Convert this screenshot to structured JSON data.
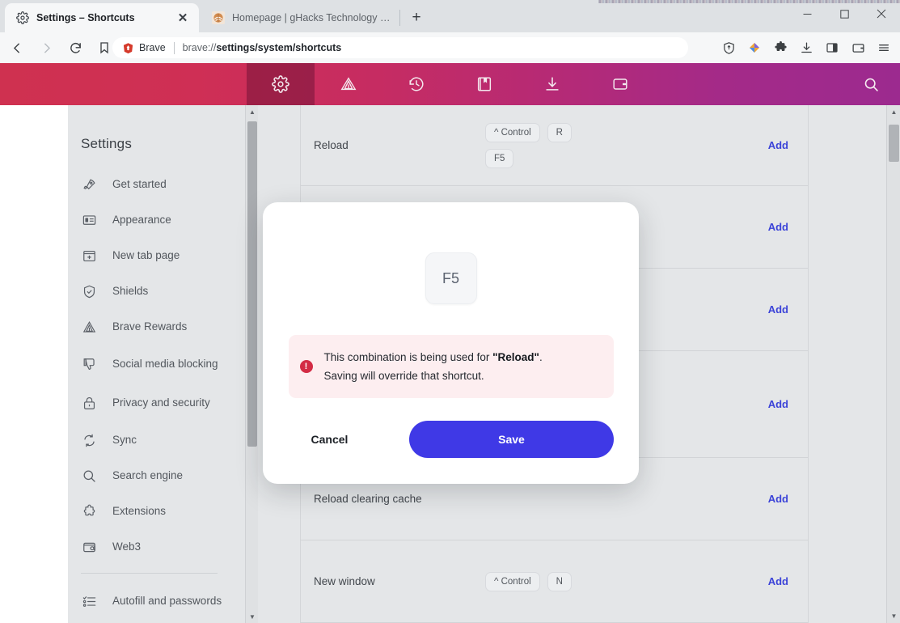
{
  "window": {
    "controls": [
      {
        "name": "minimize",
        "glyph": "—"
      },
      {
        "name": "maximize",
        "glyph": "☐"
      },
      {
        "name": "close",
        "glyph": "✕"
      }
    ]
  },
  "tabs": [
    {
      "title": "Settings – Shortcuts",
      "favicon": "gear-icon",
      "active": true,
      "close_glyph": "✕"
    },
    {
      "title": "Homepage | gHacks Technology News",
      "favicon": "ghacks-icon",
      "active": false
    }
  ],
  "newtab_label": "+",
  "navbar": {
    "back_icon": "back-arrow-icon",
    "forward_icon": "forward-arrow-icon",
    "reload_icon": "reload-icon",
    "bookmark_icon": "bookmark-icon",
    "brave_label": "Brave",
    "url_prefix": "brave://",
    "url_bold": "settings/system/shortcuts",
    "right_icons": [
      "shield-icon",
      "brave-rewards-icon",
      "extensions-icon",
      "downloads-icon",
      "sidebar-icon",
      "wallet-icon",
      "menu-icon"
    ]
  },
  "gradient_toolbar": {
    "start_color": "#cf3150",
    "end_color": "#9c2a8f",
    "items": [
      {
        "name": "settings-tab",
        "icon": "gear-icon",
        "selected": true
      },
      {
        "name": "rewards-tab",
        "icon": "brave-rewards-icon",
        "selected": false
      },
      {
        "name": "history-tab",
        "icon": "history-icon",
        "selected": false
      },
      {
        "name": "bookmarks-tab",
        "icon": "bookmarks-book-icon",
        "selected": false
      },
      {
        "name": "downloads-tab",
        "icon": "download-icon",
        "selected": false
      },
      {
        "name": "wallet-tab",
        "icon": "wallet-icon",
        "selected": false
      }
    ],
    "search_icon": "search-icon"
  },
  "sidebar": {
    "title": "Settings",
    "items": [
      {
        "label": "Get started",
        "icon": "rocket-icon"
      },
      {
        "label": "Appearance",
        "icon": "appearance-icon"
      },
      {
        "label": "New tab page",
        "icon": "new-tab-icon"
      },
      {
        "label": "Shields",
        "icon": "shield-check-icon"
      },
      {
        "label": "Brave Rewards",
        "icon": "brave-triangle-icon"
      },
      {
        "label": "Social media blocking",
        "icon": "thumbs-down-icon"
      },
      {
        "label": "Privacy and security",
        "icon": "lock-icon"
      },
      {
        "label": "Sync",
        "icon": "sync-icon"
      },
      {
        "label": "Search engine",
        "icon": "search-icon"
      },
      {
        "label": "Extensions",
        "icon": "puzzle-icon"
      },
      {
        "label": "Web3",
        "icon": "wallet-icon"
      },
      {
        "label": "Autofill and passwords",
        "icon": "list-check-icon"
      }
    ]
  },
  "shortcuts": {
    "add_label": "Add",
    "rows": [
      {
        "name": "Reload",
        "keys": [
          [
            "^ Control",
            "R"
          ],
          [
            "F5"
          ]
        ],
        "add": "Add"
      },
      {
        "name": "",
        "keys": [],
        "add": "Add"
      },
      {
        "name": "",
        "keys": [],
        "add": "Add"
      },
      {
        "name": "",
        "keys": [],
        "add": "Add"
      },
      {
        "name": "Reload clearing cache",
        "keys": [],
        "add": "Add"
      },
      {
        "name": "New window",
        "keys": [
          [
            "^ Control",
            "N"
          ]
        ],
        "add": "Add"
      }
    ]
  },
  "modal": {
    "key_label": "F5",
    "warning_icon": "error-exclamation-icon",
    "warning_line1_pre": "This combination is being used for ",
    "warning_line1_bold": "\"Reload\"",
    "warning_line1_post": ".",
    "warning_line2": "Saving will override that shortcut.",
    "cancel_label": "Cancel",
    "save_label": "Save",
    "save_color": "#3f39e6",
    "warning_bg": "#fdeef0",
    "warning_icon_color": "#d32b45"
  },
  "scrollbars": {
    "up_glyph": "▲",
    "down_glyph": "▼"
  }
}
